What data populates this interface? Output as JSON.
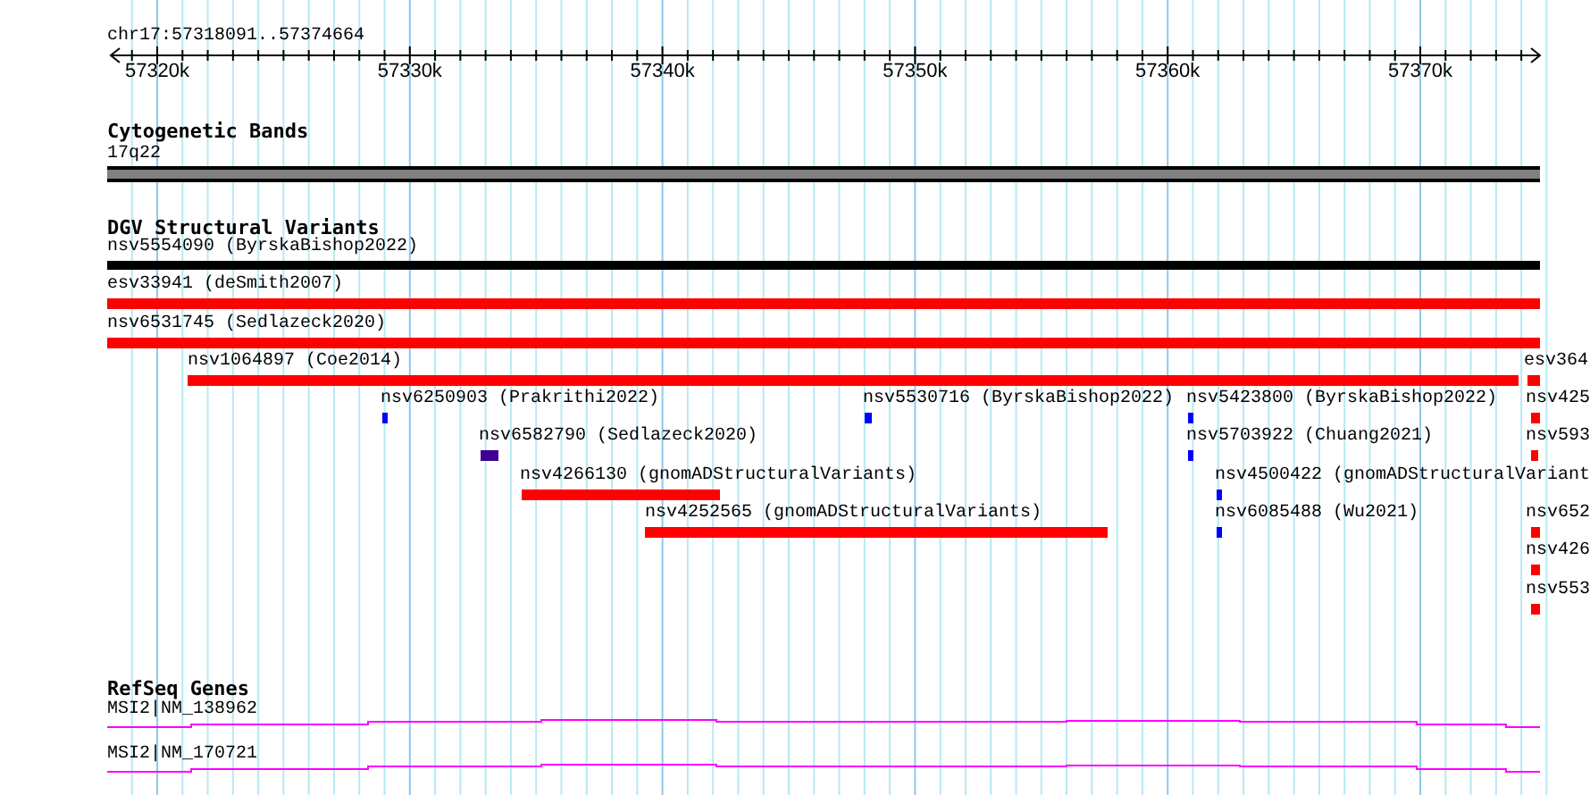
{
  "ruler": {
    "title": "chr17:57318091..57374664",
    "ticks": [
      "57320k",
      "57330k",
      "57340k",
      "57350k",
      "57360k",
      "57370k"
    ]
  },
  "cytoband_track": {
    "title": "Cytogenetic Bands",
    "band": "17q22"
  },
  "variant_track": {
    "title": "DGV Structural Variants",
    "features": [
      {
        "label": "nsv5554090 (ByrskaBishop2022)",
        "color": "#000000"
      },
      {
        "label": "esv33941 (deSmith2007)",
        "color": "#ff0000"
      },
      {
        "label": "nsv6531745 (Sedlazeck2020)",
        "color": "#ff0000"
      },
      {
        "label": "nsv1064897 (Coe2014)",
        "color": "#ff0000"
      },
      {
        "label": "esv364",
        "color": "#ff0000"
      },
      {
        "label": "nsv6250903 (Prakrithi2022)",
        "color": "#0000ff"
      },
      {
        "label": "nsv5530716 (ByrskaBishop2022)",
        "color": "#0000ff"
      },
      {
        "label": "nsv5423800 (ByrskaBishop2022)",
        "color": "#0000ff"
      },
      {
        "label": "nsv425",
        "color": "#ff0000"
      },
      {
        "label": "nsv6582790 (Sedlazeck2020)",
        "color": "#400090"
      },
      {
        "label": "nsv5703922 (Chuang2021)",
        "color": "#0000ff"
      },
      {
        "label": "nsv593",
        "color": "#ff0000"
      },
      {
        "label": "nsv4266130 (gnomADStructuralVariants)",
        "color": "#ff0000"
      },
      {
        "label": "nsv4500422 (gnomADStructuralVariant",
        "color": "#0000ff"
      },
      {
        "label": "nsv4252565 (gnomADStructuralVariants)",
        "color": "#ff0000"
      },
      {
        "label": "nsv6085488 (Wu2021)",
        "color": "#0000ff"
      },
      {
        "label": "nsv652",
        "color": "#ff0000"
      },
      {
        "label": "nsv426",
        "color": "#ff0000"
      },
      {
        "label": "nsv553",
        "color": "#ff0000"
      }
    ]
  },
  "gene_track": {
    "title": "RefSeq Genes",
    "genes": [
      {
        "label": "MSI2|NM_138962"
      },
      {
        "label": "MSI2|NM_170721"
      }
    ]
  }
}
